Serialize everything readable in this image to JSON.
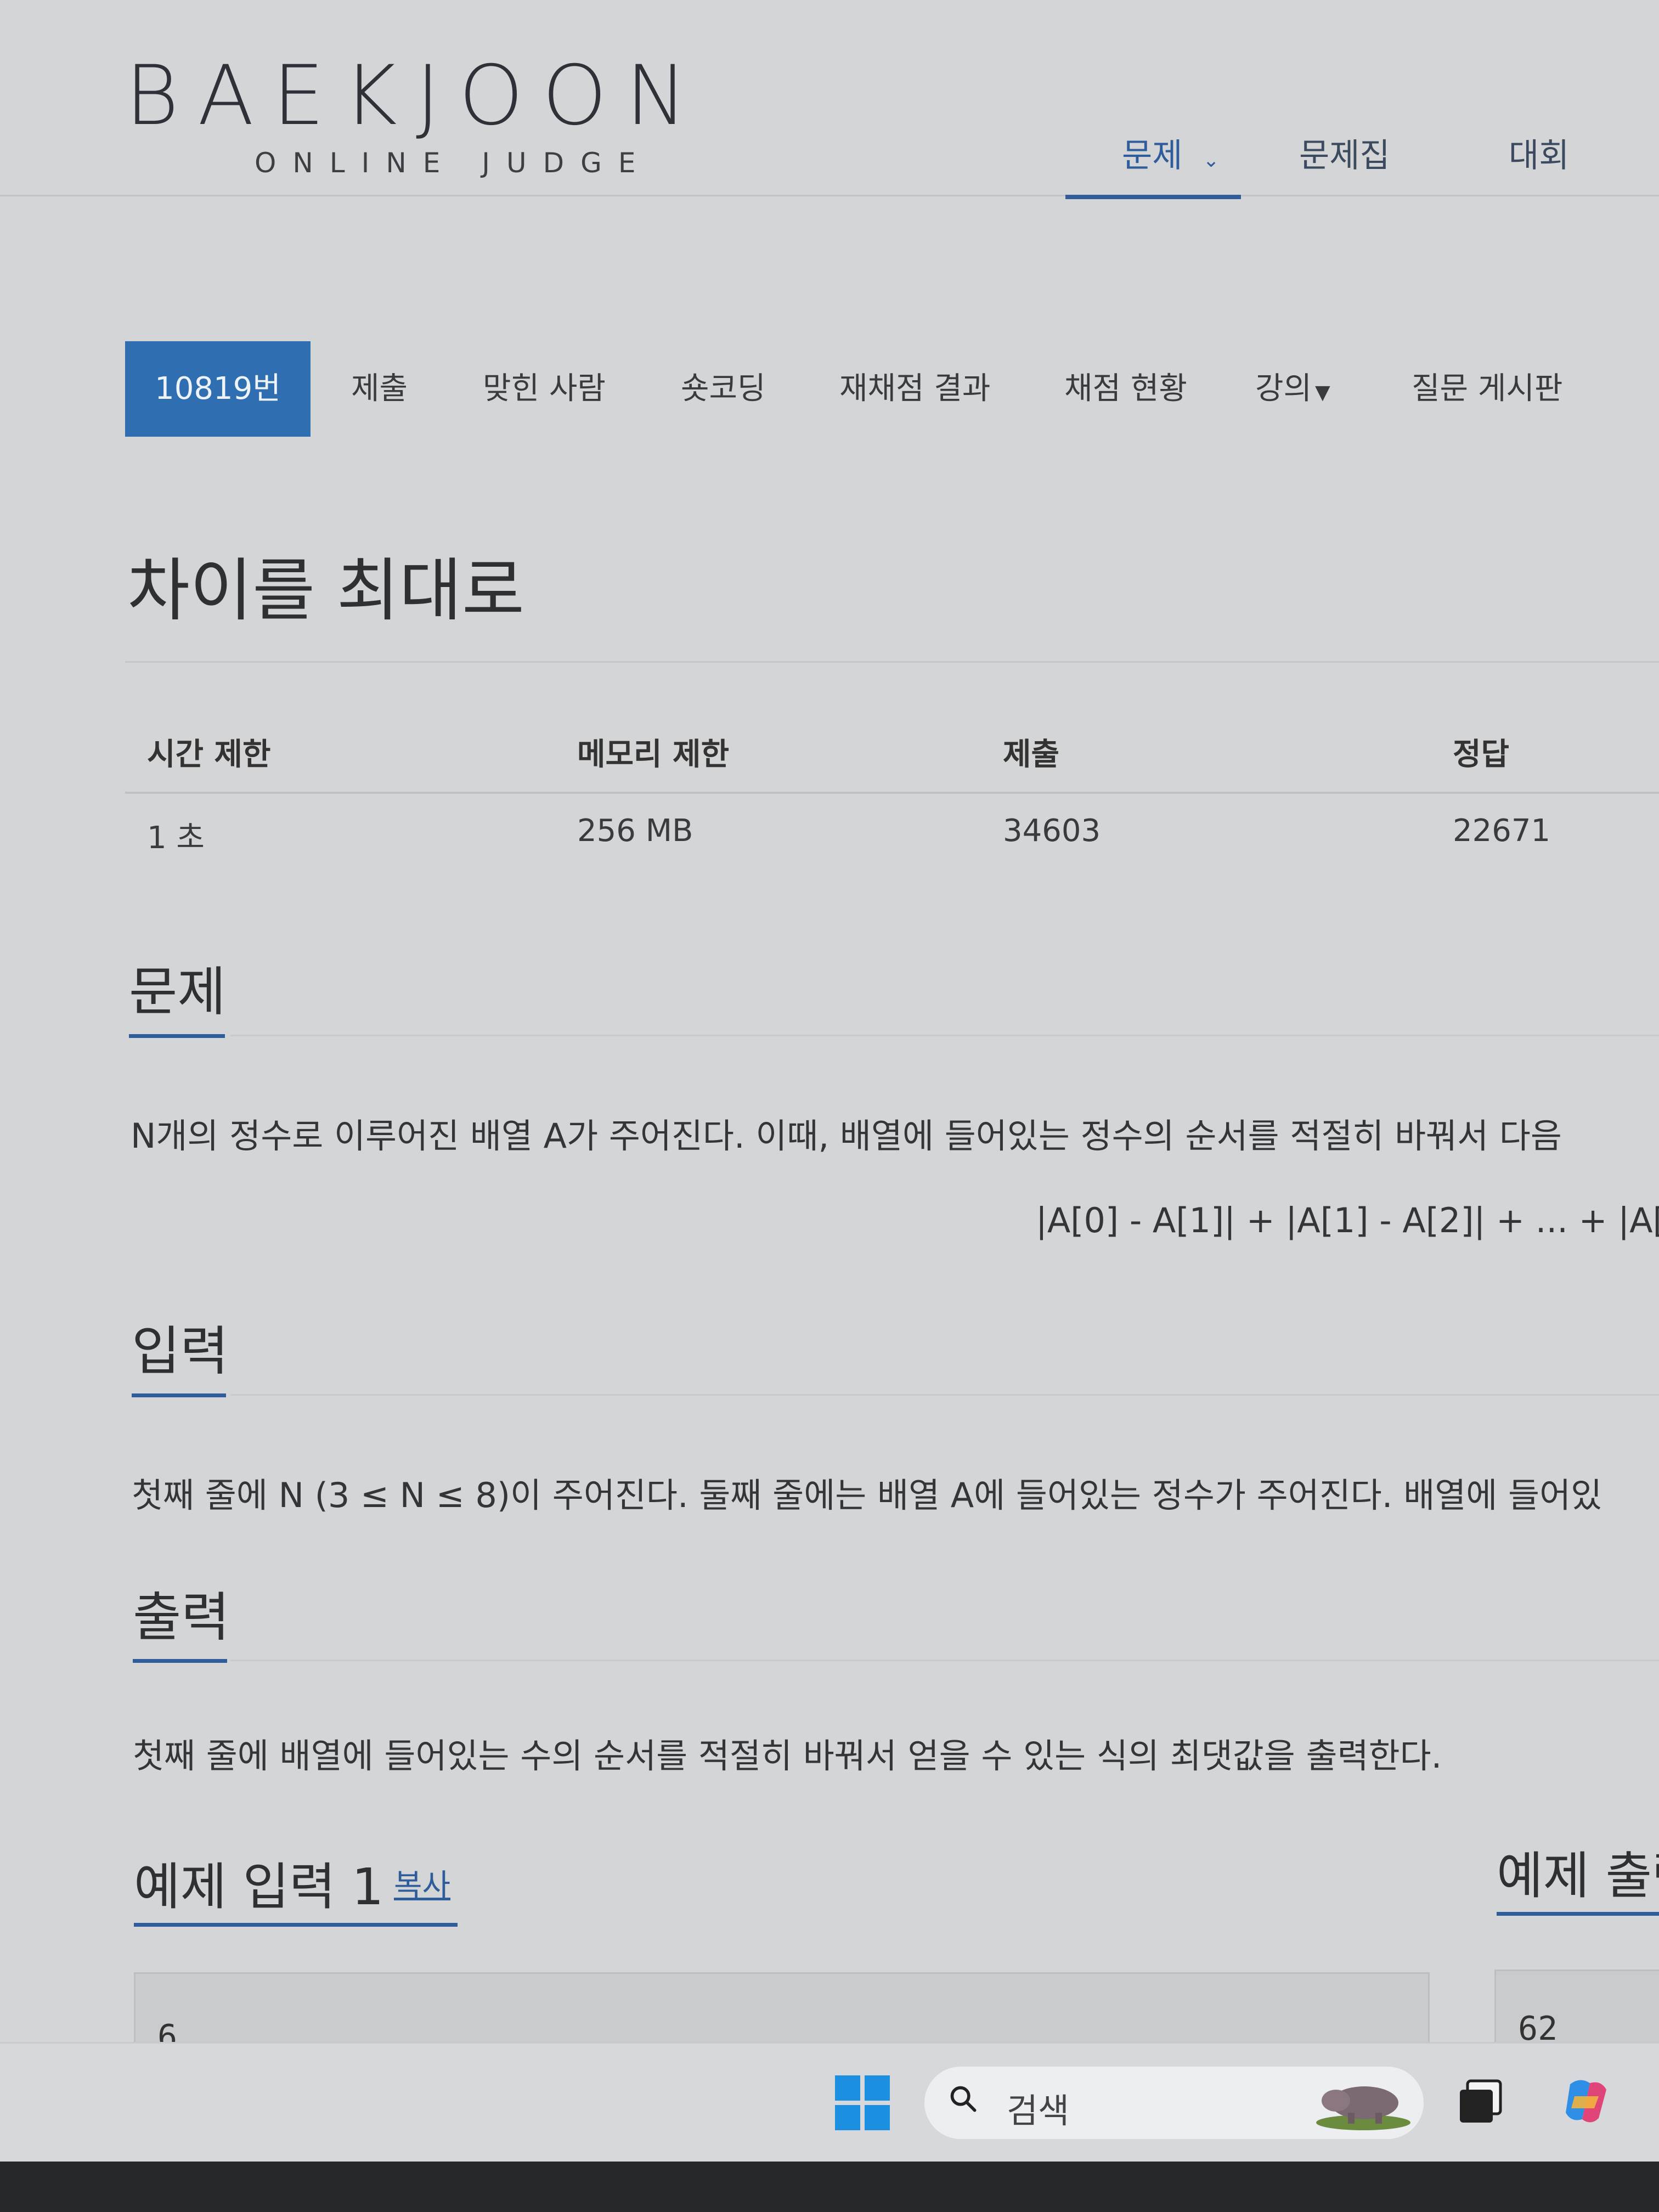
{
  "header": {
    "logo_main": "BAEKJOON",
    "logo_sub": "ONLINE JUDGE",
    "nav": {
      "problem": "문제",
      "workbook": "문제집",
      "contest": "대회"
    }
  },
  "tabs": {
    "active": "10819번",
    "submit": "제출",
    "correct_users": "맞힌 사람",
    "short_coding": "숏코딩",
    "rejudge": "재채점 결과",
    "status": "채점 현황",
    "lecture": "강의",
    "qna": "질문 게시판"
  },
  "problem_title": "차이를 최대로",
  "limits": {
    "headers": [
      "시간 제한",
      "메모리 제한",
      "제출",
      "정답"
    ],
    "values": [
      "1 초",
      "256 MB",
      "34603",
      "22671"
    ]
  },
  "sections": {
    "problem": {
      "title": "문제",
      "text": "N개의 정수로 이루어진 배열 A가 주어진다. 이때, 배열에 들어있는 정수의 순서를 적절히 바꿔서 다음",
      "formula": "|A[0] - A[1]| + |A[1] - A[2]| + ... + |A["
    },
    "input": {
      "title": "입력",
      "text": "첫째 줄에 N (3 ≤ N ≤ 8)이 주어진다. 둘째 줄에는 배열 A에 들어있는 정수가 주어진다. 배열에 들어있"
    },
    "output": {
      "title": "출력",
      "text": "첫째 줄에 배열에 들어있는 수의 순서를 적절히 바꿔서 얻을 수 있는 식의 최댓값을 출력한다."
    }
  },
  "samples": {
    "input_title": "예제 입력 1",
    "copy": "복사",
    "input_value": "6",
    "output_title": "예제 출력",
    "output_value": "62"
  },
  "taskbar": {
    "search_placeholder": "검색",
    "icons": [
      "windows-start-icon",
      "search-icon",
      "task-view-icon",
      "copilot-icon"
    ]
  },
  "colors": {
    "accent": "#2f6fb1",
    "link": "#2f5c9a",
    "background": "#d4d5d6"
  }
}
